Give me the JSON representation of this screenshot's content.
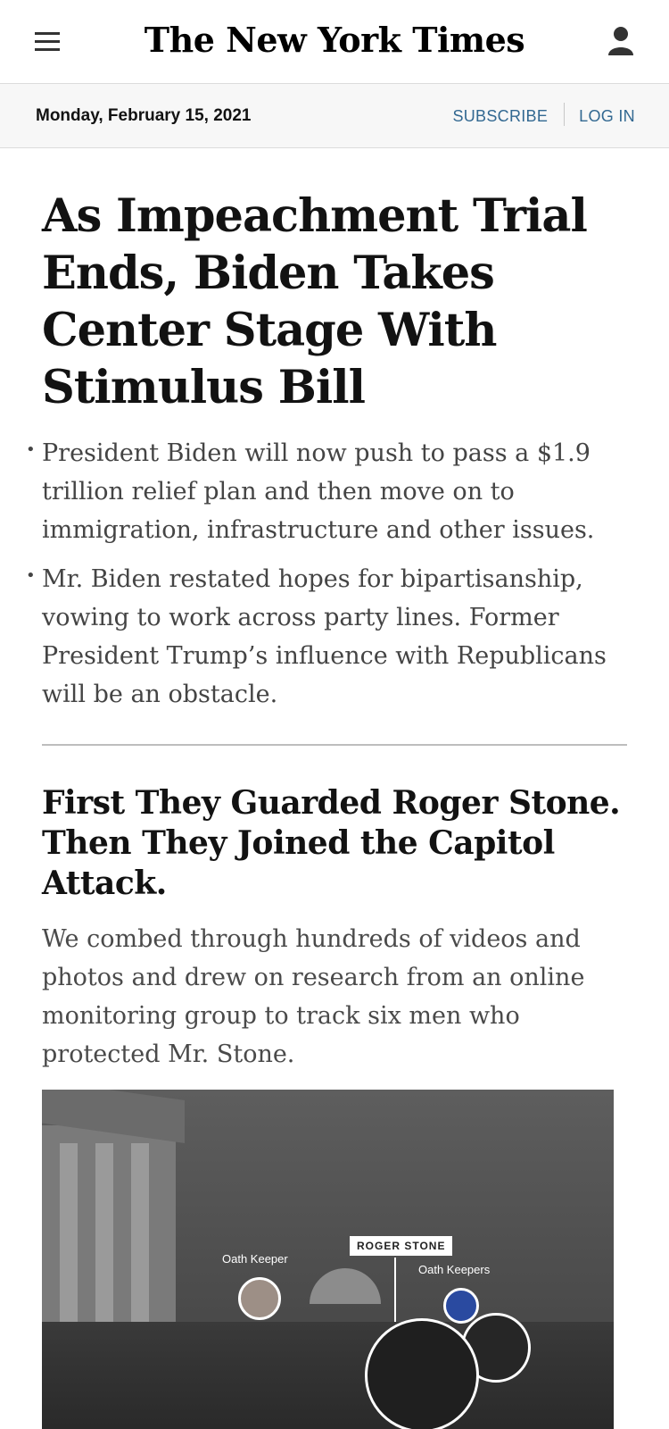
{
  "header": {
    "logo": "The New York Times",
    "menu_icon": "hamburger-menu-icon",
    "account_icon": "user-account-icon"
  },
  "datebar": {
    "date": "Monday, February 15, 2021",
    "subscribe": "SUBSCRIBE",
    "login": "LOG IN"
  },
  "story1": {
    "headline": "As Impeachment Trial Ends, Biden Takes Center Stage With Stimulus Bill",
    "bullets": [
      "President Biden will now push to pass a $1.9 trillion relief plan and then move on to immigration, infrastructure and other issues.",
      "Mr. Biden restated hopes for bipartisanship, vowing to work across party lines. Former President Trump’s influence with Republicans will be an obstacle."
    ]
  },
  "story2": {
    "headline": "First They Guarded Roger Stone. Then They Joined the Capitol Attack.",
    "summary": "We combed through hundreds of videos and photos and drew on research from an online monitoring group to track six men who protected Mr. Stone.",
    "image_labels": {
      "roger_stone": "ROGER STONE",
      "oath_keeper": "Oath Keeper",
      "oath_keepers": "Oath Keepers"
    }
  },
  "colors": {
    "link": "#326891",
    "datebar_bg": "#f7f7f7",
    "text": "#121212",
    "summary_text": "#4a4a4a"
  }
}
